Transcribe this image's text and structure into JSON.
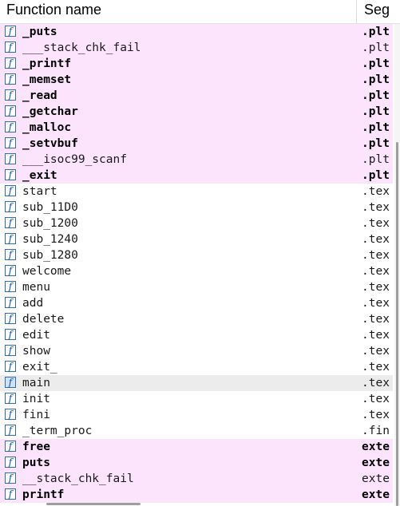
{
  "header": {
    "function_name": "Function name",
    "segment": "Seg"
  },
  "rows": [
    {
      "name": "_puts",
      "segment": ".plt",
      "style": "pink-bold",
      "icon": "function-icon"
    },
    {
      "name": "___stack_chk_fail",
      "segment": ".plt",
      "style": "pink",
      "icon": "function-icon"
    },
    {
      "name": "_printf",
      "segment": ".plt",
      "style": "pink-bold",
      "icon": "function-icon"
    },
    {
      "name": "_memset",
      "segment": ".plt",
      "style": "pink-bold",
      "icon": "function-icon"
    },
    {
      "name": "_read",
      "segment": ".plt",
      "style": "pink-bold",
      "icon": "function-icon"
    },
    {
      "name": "_getchar",
      "segment": ".plt",
      "style": "pink-bold",
      "icon": "function-icon"
    },
    {
      "name": "_malloc",
      "segment": ".plt",
      "style": "pink-bold",
      "icon": "function-icon"
    },
    {
      "name": "_setvbuf",
      "segment": ".plt",
      "style": "pink-bold",
      "icon": "function-icon"
    },
    {
      "name": "___isoc99_scanf",
      "segment": ".plt",
      "style": "pink",
      "icon": "function-icon"
    },
    {
      "name": "_exit",
      "segment": ".plt",
      "style": "pink-bold",
      "icon": "function-icon"
    },
    {
      "name": "start",
      "segment": ".tex",
      "style": "normal",
      "icon": "function-icon"
    },
    {
      "name": "sub_11D0",
      "segment": ".tex",
      "style": "normal",
      "icon": "function-icon"
    },
    {
      "name": "sub_1200",
      "segment": ".tex",
      "style": "normal",
      "icon": "function-icon"
    },
    {
      "name": "sub_1240",
      "segment": ".tex",
      "style": "normal",
      "icon": "function-icon"
    },
    {
      "name": "sub_1280",
      "segment": ".tex",
      "style": "normal",
      "icon": "function-icon"
    },
    {
      "name": "welcome",
      "segment": ".tex",
      "style": "normal",
      "icon": "function-icon"
    },
    {
      "name": "menu",
      "segment": ".tex",
      "style": "normal",
      "icon": "function-icon"
    },
    {
      "name": "add",
      "segment": ".tex",
      "style": "normal",
      "icon": "function-icon"
    },
    {
      "name": "delete",
      "segment": ".tex",
      "style": "normal",
      "icon": "function-icon"
    },
    {
      "name": "edit",
      "segment": ".tex",
      "style": "normal",
      "icon": "function-icon"
    },
    {
      "name": "show",
      "segment": ".tex",
      "style": "normal",
      "icon": "function-icon"
    },
    {
      "name": "exit_",
      "segment": ".tex",
      "style": "normal",
      "icon": "function-icon"
    },
    {
      "name": "main",
      "segment": ".tex",
      "style": "selected",
      "icon": "function-icon"
    },
    {
      "name": "init",
      "segment": ".tex",
      "style": "normal",
      "icon": "function-icon"
    },
    {
      "name": "fini",
      "segment": ".tex",
      "style": "normal",
      "icon": "function-icon"
    },
    {
      "name": "_term_proc",
      "segment": ".fin",
      "style": "normal",
      "icon": "function-icon"
    },
    {
      "name": "free",
      "segment": "exte",
      "style": "pink-bold",
      "icon": "function-icon"
    },
    {
      "name": "puts",
      "segment": "exte",
      "style": "pink-bold",
      "icon": "function-icon"
    },
    {
      "name": "__stack_chk_fail",
      "segment": "exte",
      "style": "pink",
      "icon": "function-icon"
    },
    {
      "name": "printf",
      "segment": "exte",
      "style": "pink-bold",
      "icon": "function-icon"
    }
  ],
  "colors": {
    "library_row_bg": "#fde4fd",
    "selected_row_bg": "#ececec",
    "icon_border": "#2f6fb0"
  }
}
